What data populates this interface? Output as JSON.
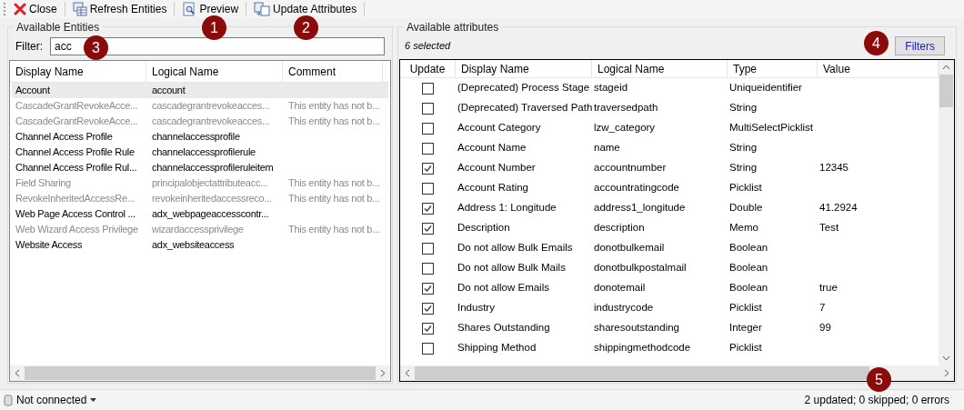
{
  "toolbar": {
    "buttons": [
      {
        "kind": "close",
        "label": "Close"
      },
      {
        "kind": "refresh",
        "label": "Refresh Entities"
      },
      {
        "kind": "preview",
        "label": "Preview"
      },
      {
        "kind": "update",
        "label": "Update Attributes"
      }
    ]
  },
  "entities": {
    "title": "Available Entities",
    "filter_label": "Filter:",
    "filter_value": "acc",
    "columns": [
      "Display Name",
      "Logical Name",
      "Comment"
    ],
    "rows": [
      {
        "display": "Account",
        "logical": "account",
        "comment": "",
        "selected": true,
        "disabled": false
      },
      {
        "display": "CascadeGrantRevokeAcce...",
        "logical": "cascadegrantrevokeacces...",
        "comment": "This entity has not b...",
        "selected": false,
        "disabled": true
      },
      {
        "display": "CascadeGrantRevokeAcce...",
        "logical": "cascadegrantrevokeacces...",
        "comment": "This entity has not b...",
        "selected": false,
        "disabled": true
      },
      {
        "display": "Channel Access Profile",
        "logical": "channelaccessprofile",
        "comment": "",
        "selected": false,
        "disabled": false
      },
      {
        "display": "Channel Access Profile Rule",
        "logical": "channelaccessprofilerule",
        "comment": "",
        "selected": false,
        "disabled": false
      },
      {
        "display": "Channel Access Profile Rul...",
        "logical": "channelaccessprofileruleitem",
        "comment": "",
        "selected": false,
        "disabled": false
      },
      {
        "display": "Field Sharing",
        "logical": "principalobjectattributeacc...",
        "comment": "This entity has not b...",
        "selected": false,
        "disabled": true
      },
      {
        "display": "RevokeInheritedAccessRe...",
        "logical": "revokeinheritedaccessreco...",
        "comment": "This entity has not b...",
        "selected": false,
        "disabled": true
      },
      {
        "display": "Web Page Access Control ...",
        "logical": "adx_webpageaccesscontr...",
        "comment": "",
        "selected": false,
        "disabled": false
      },
      {
        "display": "Web Wizard Access Privilege",
        "logical": "wizardaccessprivilege",
        "comment": "This entity has not b...",
        "selected": false,
        "disabled": true
      },
      {
        "display": "Website Access",
        "logical": "adx_websiteaccess",
        "comment": "",
        "selected": false,
        "disabled": false
      }
    ]
  },
  "attributes": {
    "title": "Available attributes",
    "selected_count": "6 selected",
    "filters_button": "Filters",
    "columns": [
      "Update",
      "Display Name",
      "Logical Name",
      "Type",
      "Value"
    ],
    "rows": [
      {
        "checked": false,
        "display": "(Deprecated) Process Stage",
        "logical": "stageid",
        "type": "Uniqueidentifier",
        "value": ""
      },
      {
        "checked": false,
        "display": "(Deprecated) Traversed Path",
        "logical": "traversedpath",
        "type": "String",
        "value": ""
      },
      {
        "checked": false,
        "display": "Account Category",
        "logical": "lzw_category",
        "type": "MultiSelectPicklist",
        "value": ""
      },
      {
        "checked": false,
        "display": "Account Name",
        "logical": "name",
        "type": "String",
        "value": ""
      },
      {
        "checked": true,
        "display": "Account Number",
        "logical": "accountnumber",
        "type": "String",
        "value": "12345"
      },
      {
        "checked": false,
        "display": "Account Rating",
        "logical": "accountratingcode",
        "type": "Picklist",
        "value": ""
      },
      {
        "checked": true,
        "display": "Address 1: Longitude",
        "logical": "address1_longitude",
        "type": "Double",
        "value": "41.2924"
      },
      {
        "checked": true,
        "display": "Description",
        "logical": "description",
        "type": "Memo",
        "value": "Test"
      },
      {
        "checked": false,
        "display": "Do not allow Bulk Emails",
        "logical": "donotbulkemail",
        "type": "Boolean",
        "value": ""
      },
      {
        "checked": false,
        "display": "Do not allow Bulk Mails",
        "logical": "donotbulkpostalmail",
        "type": "Boolean",
        "value": ""
      },
      {
        "checked": true,
        "display": "Do not allow Emails",
        "logical": "donotemail",
        "type": "Boolean",
        "value": "true"
      },
      {
        "checked": true,
        "display": "Industry",
        "logical": "industrycode",
        "type": "Picklist",
        "value": "7"
      },
      {
        "checked": true,
        "display": "Shares Outstanding",
        "logical": "sharesoutstanding",
        "type": "Integer",
        "value": "99"
      },
      {
        "checked": false,
        "display": "Shipping Method",
        "logical": "shippingmethodcode",
        "type": "Picklist",
        "value": ""
      }
    ]
  },
  "status_bar": {
    "connection": "Not connected",
    "summary": "2 updated; 0 skipped; 0 errors"
  },
  "callouts": [
    "1",
    "2",
    "3",
    "4",
    "5"
  ]
}
